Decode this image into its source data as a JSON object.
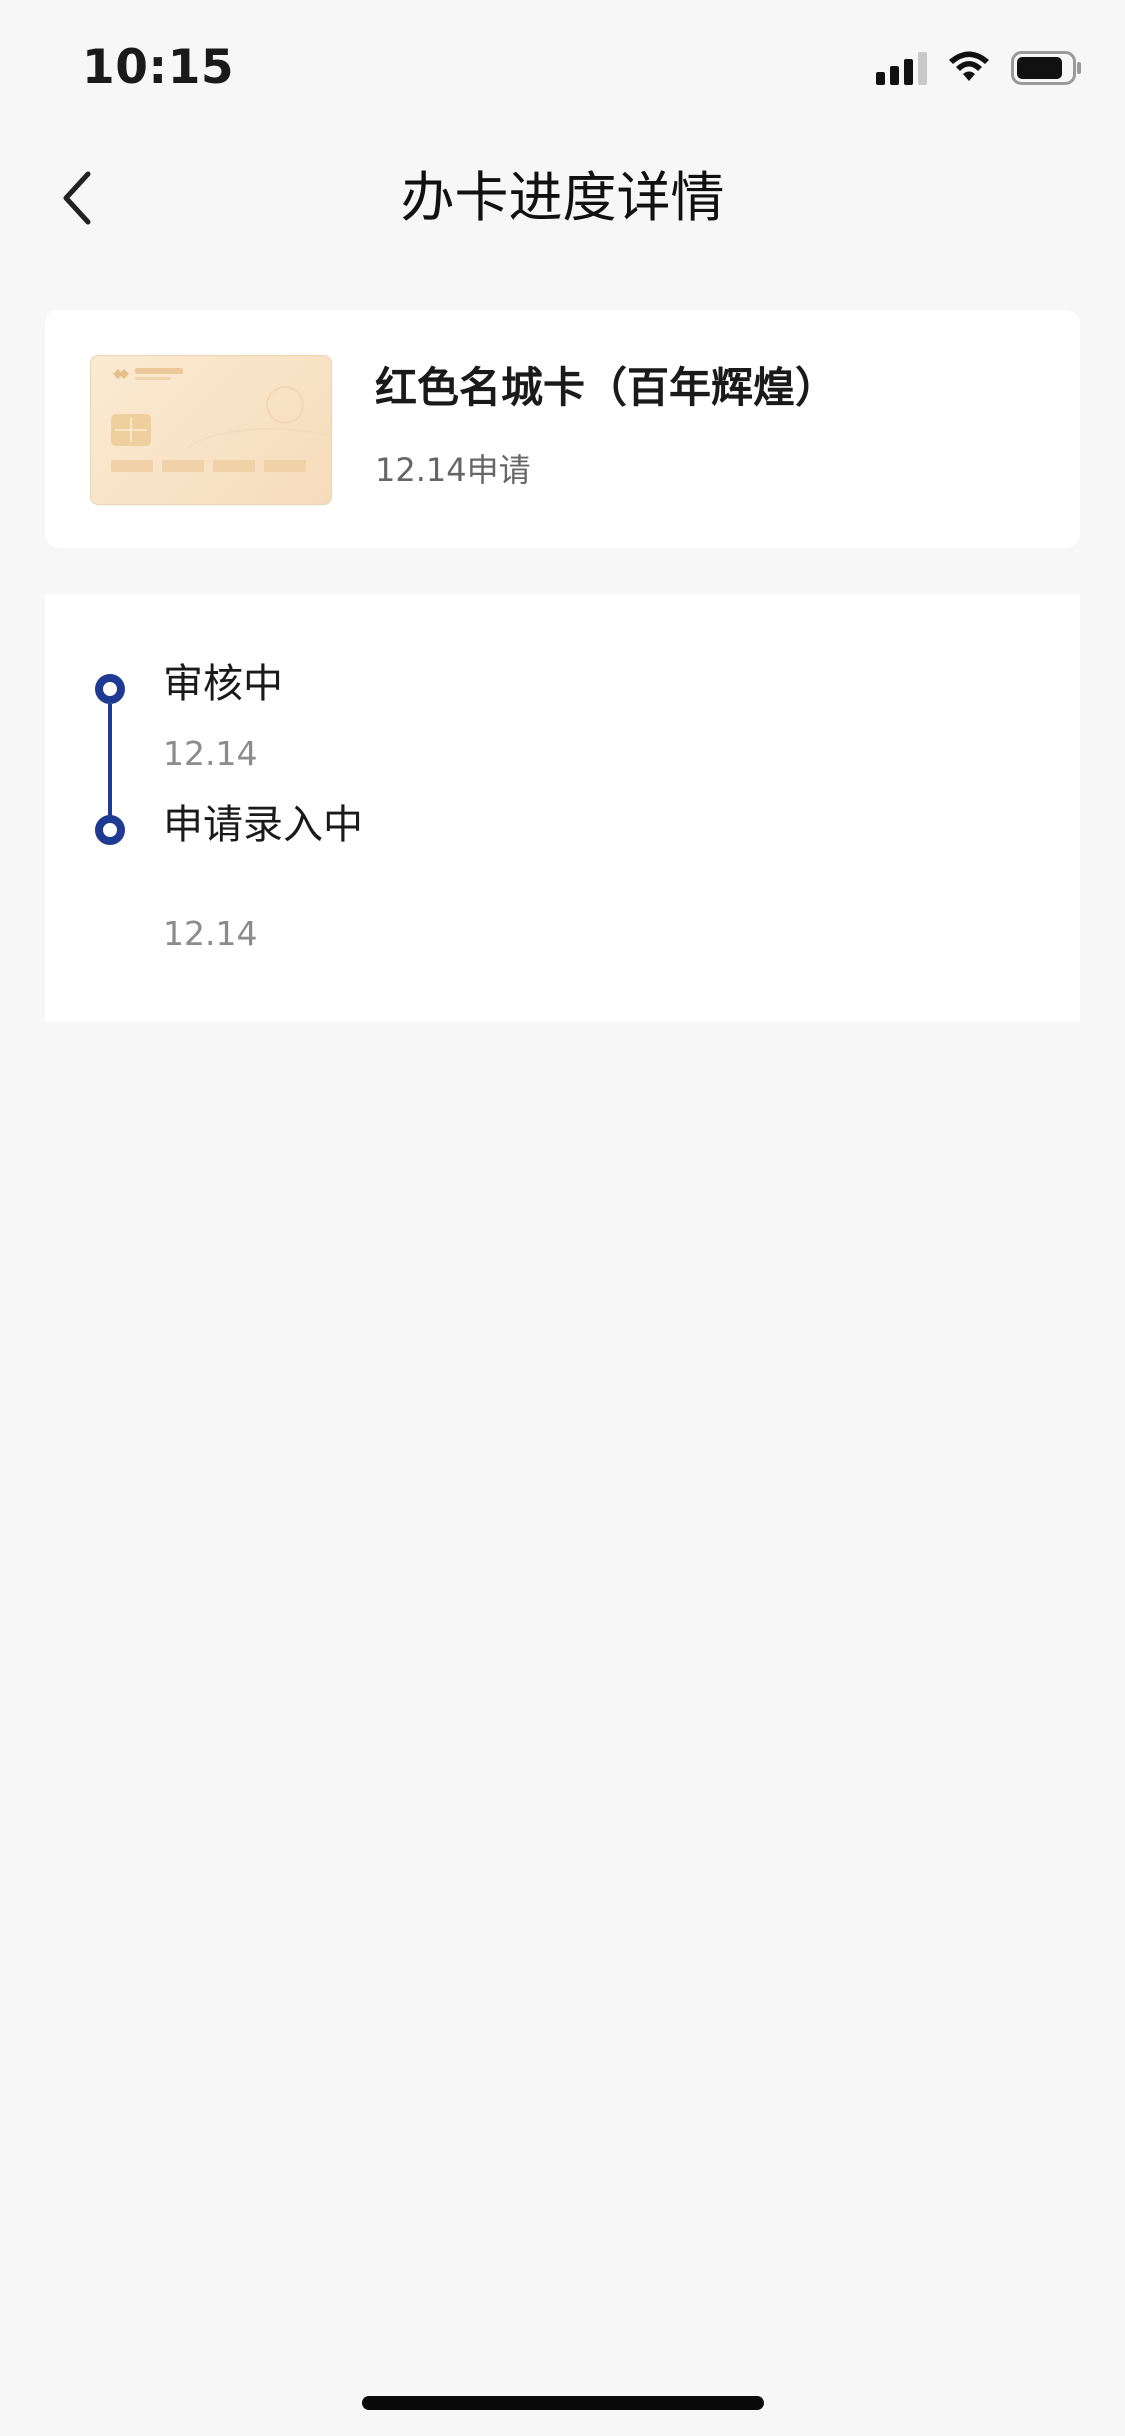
{
  "status_bar": {
    "time": "10:15",
    "icons": [
      "signal-icon",
      "wifi-icon",
      "battery-icon"
    ],
    "battery_level": 0.85,
    "signal_bars_active": 3,
    "signal_bars_total": 4
  },
  "nav": {
    "back_icon": "chevron-left-icon",
    "title": "办卡进度详情"
  },
  "card": {
    "name": "红色名城卡（百年辉煌）",
    "apply_date": "12.14申请",
    "image_icon": "credit-card-image"
  },
  "progress": {
    "accent_color": "#1f3a93",
    "steps": [
      {
        "title": "审核中",
        "date": "12.14"
      },
      {
        "title": "申请录入中",
        "date": "12.14"
      }
    ]
  },
  "colors": {
    "background": "#f7f7f7",
    "card_background": "#ffffff",
    "secondary_text": "#8c8c8c"
  }
}
